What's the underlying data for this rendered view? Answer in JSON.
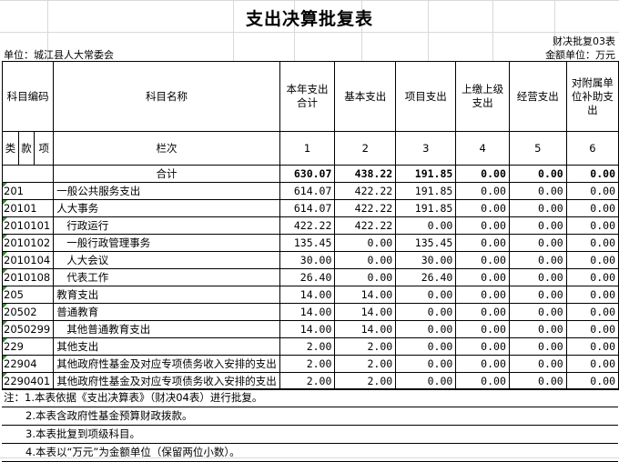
{
  "title": "支出决算批复表",
  "report_code": "财决批复03表",
  "unit_label": "单位：城江县人大常委会",
  "amount_unit": "金额单位：万元",
  "headers": {
    "code": "科目编码",
    "name": "科目名称",
    "total": "本年支出合计",
    "basic": "基本支出",
    "project": "项目支出",
    "upper": "上缴上级支出",
    "business": "经营支出",
    "subsidy": "对附属单位补助支出",
    "lei": "类",
    "kuan": "款",
    "xiang": "项"
  },
  "col_index": {
    "label": "栏次",
    "numbers": [
      "1",
      "2",
      "3",
      "4",
      "5",
      "6"
    ]
  },
  "total_row": {
    "label": "合计",
    "values": [
      "630.07",
      "438.22",
      "191.85",
      "0.00",
      "0.00",
      "0.00"
    ]
  },
  "rows": [
    {
      "code": "201",
      "name": "一般公共服务支出",
      "values": [
        "614.07",
        "422.22",
        "191.85",
        "0.00",
        "0.00",
        "0.00"
      ]
    },
    {
      "code": "20101",
      "name": "人大事务",
      "values": [
        "614.07",
        "422.22",
        "191.85",
        "0.00",
        "0.00",
        "0.00"
      ]
    },
    {
      "code": "2010101",
      "name": "行政运行",
      "values": [
        "422.22",
        "422.22",
        "0.00",
        "0.00",
        "0.00",
        "0.00"
      ]
    },
    {
      "code": "2010102",
      "name": "一般行政管理事务",
      "values": [
        "135.45",
        "0.00",
        "135.45",
        "0.00",
        "0.00",
        "0.00"
      ]
    },
    {
      "code": "2010104",
      "name": "人大会议",
      "values": [
        "30.00",
        "0.00",
        "30.00",
        "0.00",
        "0.00",
        "0.00"
      ]
    },
    {
      "code": "2010108",
      "name": "代表工作",
      "values": [
        "26.40",
        "0.00",
        "26.40",
        "0.00",
        "0.00",
        "0.00"
      ]
    },
    {
      "code": "205",
      "name": "教育支出",
      "values": [
        "14.00",
        "14.00",
        "0.00",
        "0.00",
        "0.00",
        "0.00"
      ]
    },
    {
      "code": "20502",
      "name": "普通教育",
      "values": [
        "14.00",
        "14.00",
        "0.00",
        "0.00",
        "0.00",
        "0.00"
      ]
    },
    {
      "code": "2050299",
      "name": "其他普通教育支出",
      "values": [
        "14.00",
        "14.00",
        "0.00",
        "0.00",
        "0.00",
        "0.00"
      ]
    },
    {
      "code": "229",
      "name": "其他支出",
      "values": [
        "2.00",
        "2.00",
        "0.00",
        "0.00",
        "0.00",
        "0.00"
      ]
    },
    {
      "code": "22904",
      "name": "其他政府性基金及对应专项债务收入安排的支出",
      "values": [
        "2.00",
        "2.00",
        "0.00",
        "0.00",
        "0.00",
        "0.00"
      ]
    },
    {
      "code": "2290401",
      "name": "其他政府性基金及对应专项债务收入安排的支出",
      "values": [
        "2.00",
        "2.00",
        "0.00",
        "0.00",
        "0.00",
        "0.00"
      ]
    }
  ],
  "notes": [
    "注：1.本表依据《支出决算表》（财决04表）进行批复。",
    "2.本表含政府性基金预算财政拨款。",
    "3.本表批复到项级科目。",
    "4.本表以“万元”为金额单位（保留两位小数）。"
  ]
}
